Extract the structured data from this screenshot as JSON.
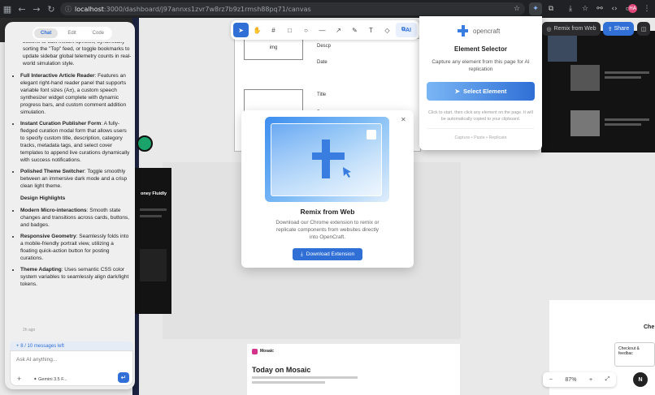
{
  "browser": {
    "url_host": "localhost",
    "url_path": ":3000/dashboard/j97annxs1zvr7w8rz7b9z1rmsh88pq71/canvas",
    "avatar_initials": "HA"
  },
  "toolbar": {
    "ai_label": "AI"
  },
  "chat": {
    "tabs": [
      "Chat",
      "Edit",
      "Code"
    ],
    "message": {
      "intro": "bookmarking, Users can click the thumbs-up buttons to cast instant upvotes, dynamically sorting the \"Top\" feed, or toggle bookmarks to update sidebar global telemetry counts in real-world simulation style.",
      "features": [
        {
          "title": "Full Interactive Article Reader",
          "text": ": Features an elegant right-hand reader panel that supports variable font sizes (A±), a custom speech synthesizer widget complete with dynamic progress bars, and custom comment addition simulation."
        },
        {
          "title": "Instant Curation Publisher Form",
          "text": ": A fully-fledged curation modal form that allows users to specify custom title, description, category tracks, metadata tags, and select cover templates to append live curations dynamically with success notifications."
        },
        {
          "title": "Polished Theme Switcher",
          "text": ": Toggle smoothly between an immersive dark mode and a crisp clean light theme."
        }
      ],
      "highlights_heading": "Design Highlights",
      "highlights": [
        {
          "title": "Modern Micro-interactions",
          "text": ": Smooth state changes and transitions across cards, buttons, and badges."
        },
        {
          "title": "Responsive Geometry",
          "text": ": Seamlessly folds into a mobile-friendly portrait view, utilizing a floating quick-action button for posting curations."
        },
        {
          "title": "Theme Adapting",
          "text": ": Uses semantic CSS color system variables to seamlessly align dark/light tokens."
        }
      ],
      "time": "2h ago"
    },
    "limit": "8 / 10 messages left",
    "input_placeholder": "Ask AI anything...",
    "model": "Gemini 3.5 F..."
  },
  "remix_modal": {
    "title": "Remix from Web",
    "description": "Download our Chrome extension to remix or replicate components from websites directly into OpenCraft.",
    "button": "Download Extension"
  },
  "element_selector": {
    "brand": "opencraft",
    "title": "Element Selector",
    "description": "Capture any element from this page for AI replication",
    "button": "Select Element",
    "hint": "Click to start, then click any element on the page. It will be automatically copied to your clipboard.",
    "footer": "Capture • Paste • Replicate"
  },
  "top_right": {
    "remix_label": "Remix from Web",
    "share_label": "Share"
  },
  "canvas_texts": {
    "desc": "Descp",
    "date": "Date",
    "title": "Title",
    "img": "img",
    "money": "oney Fluidly",
    "mosaic_heading": "Today on Mosaic",
    "mosaic_brand": "Mosaic",
    "checkout": "Checkout & feedbac",
    "che": "Che"
  },
  "zoom": {
    "level": "87%"
  }
}
